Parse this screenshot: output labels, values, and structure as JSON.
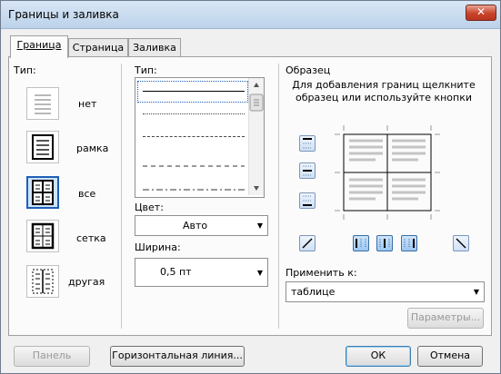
{
  "window": {
    "title": "Границы и заливка",
    "close_glyph": "✕"
  },
  "tabs": [
    {
      "label": "Граница",
      "active": true
    },
    {
      "label": "Страница",
      "active": false
    },
    {
      "label": "Заливка",
      "active": false
    }
  ],
  "setting": {
    "label": "Тип:",
    "items": [
      {
        "name": "нет",
        "selected": false
      },
      {
        "name": "рамка",
        "selected": false
      },
      {
        "name": "все",
        "selected": true
      },
      {
        "name": "сетка",
        "selected": false
      },
      {
        "name": "другая",
        "selected": false
      }
    ]
  },
  "style": {
    "label": "Тип:",
    "lines": [
      "solid",
      "dotted",
      "dashed-fine",
      "dashed",
      "dash-dot"
    ],
    "color_label": "Цвет:",
    "color_value": "Авто",
    "width_label": "Ширина:",
    "width_value": "0,5 пт"
  },
  "preview": {
    "label": "Образец",
    "hint": "Для добавления границ щелкните образец или используйте кнопки",
    "apply_label": "Применить к:",
    "apply_value": "таблице",
    "params_button": "Параметры..."
  },
  "footer": {
    "panel_button": "Панель",
    "hline_button": "Горизонтальная линия...",
    "ok_button": "ОК",
    "cancel_button": "Отмена"
  },
  "colors": {
    "accent": "#1d5fb7",
    "title_bg": "#bcd2ea",
    "close": "#c9432b"
  }
}
